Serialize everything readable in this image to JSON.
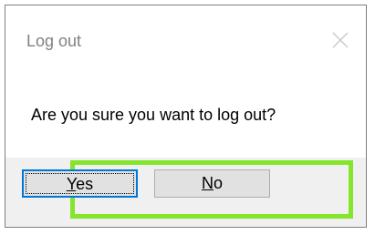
{
  "dialog": {
    "title": "Log out",
    "message": "Are you sure you want to log out?",
    "close_icon": "close-icon",
    "buttons": {
      "yes": {
        "mnemonic": "Y",
        "rest": "es"
      },
      "no": {
        "mnemonic": "N",
        "rest": "o"
      }
    },
    "highlight_color": "#84e52a",
    "default_button_border_color": "#0078d7"
  }
}
